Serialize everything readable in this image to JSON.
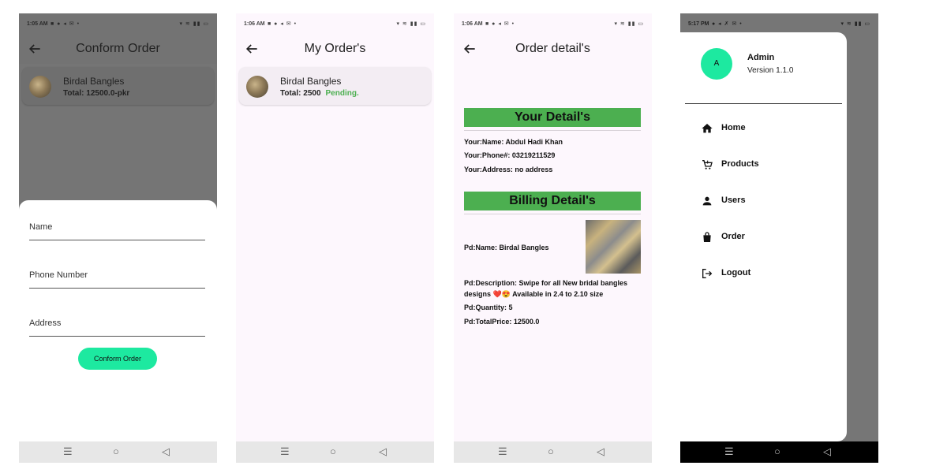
{
  "screen1": {
    "time": "1:05 AM",
    "title": "Conform Order",
    "item": {
      "title": "Birdal Bangles",
      "subtitle": "Total: 12500.0-pkr"
    },
    "fields": [
      "Name",
      "Phone Number",
      "Address"
    ],
    "button": "Conform Order"
  },
  "screen2": {
    "time": "1:06 AM",
    "title": "My Order's",
    "item": {
      "title": "Birdal Bangles",
      "total": "Total: 2500",
      "status": "Pending."
    }
  },
  "screen3": {
    "time": "1:06 AM",
    "title": "Order detail's",
    "your_header": "Your Detail's",
    "name": "Your:Name: Abdul Hadi Khan",
    "phone": "Your:Phone#: 03219211529",
    "address": "Your:Address: no address",
    "billing_header": "Billing Detail's",
    "pd_name": "Pd:Name: Birdal Bangles",
    "pd_description": "Pd:Description: Swipe for all New bridal bangles designs ❤️😍 Available in 2.4 to 2.10 size",
    "pd_quantity": "Pd:Quantity: 5",
    "pd_total": "Pd:TotalPrice: 12500.0"
  },
  "screen4": {
    "time": "5:17 PM",
    "avatar": "A",
    "name": "Admin",
    "version": "Version 1.1.0",
    "menu": [
      {
        "label": "Home",
        "icon": "home-icon"
      },
      {
        "label": "Products",
        "icon": "cart-icon"
      },
      {
        "label": "Users",
        "icon": "person-icon"
      },
      {
        "label": "Order",
        "icon": "bag-icon"
      },
      {
        "label": "Logout",
        "icon": "logout-icon"
      }
    ]
  },
  "nav_icons": [
    "menu-icon",
    "home-circle-icon",
    "back-triangle-icon"
  ],
  "colors": {
    "accent": "#1de9a0",
    "header_green": "#4caf50",
    "pending": "#4caf50",
    "background": "#fdf7fd"
  }
}
